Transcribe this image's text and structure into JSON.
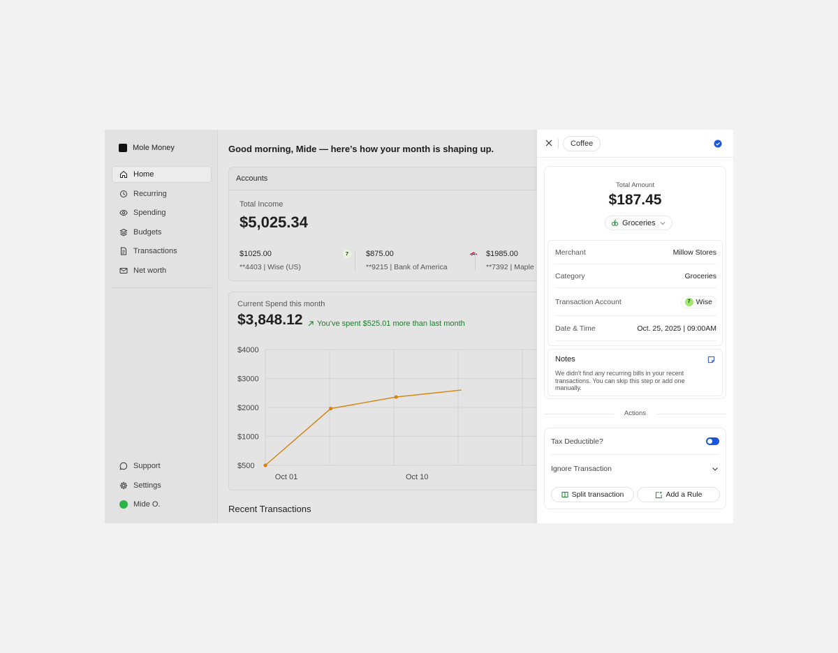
{
  "app": {
    "name": "Mole Money"
  },
  "sidebar": {
    "items": [
      {
        "label": "Home",
        "icon": "home-icon",
        "active": true
      },
      {
        "label": "Recurring",
        "icon": "recurring-icon"
      },
      {
        "label": "Spending",
        "icon": "eye-icon"
      },
      {
        "label": "Budgets",
        "icon": "layers-icon"
      },
      {
        "label": "Transactions",
        "icon": "document-icon"
      },
      {
        "label": "Net worth",
        "icon": "mail-icon"
      }
    ],
    "bottom": [
      {
        "label": "Support",
        "icon": "chat-icon"
      },
      {
        "label": "Settings",
        "icon": "gear-icon"
      },
      {
        "label": "Mide O.",
        "icon": "avatar"
      }
    ]
  },
  "main": {
    "greeting": "Good morning, Mide — here’s how your month is shaping up.",
    "accounts": {
      "title": "Accounts",
      "income_label": "Total Income",
      "income_value": "$5,025.34",
      "list": [
        {
          "amount": "$1025.00",
          "detail": "**4403 | Wise (US)",
          "icon": "wise-icon"
        },
        {
          "amount": "$875.00",
          "detail": "**9215 | Bank of America",
          "icon": "bofa-icon"
        },
        {
          "amount": "$1985.00",
          "detail": "**7392 | Maple",
          "icon": ""
        }
      ]
    },
    "spend": {
      "label": "Current Spend this month",
      "value": "$3,848.12",
      "trend": "You’ve spent $525.01 more than last month",
      "trend_color": "#1d7a2c"
    },
    "recent_title": "Recent Transactions"
  },
  "chart_data": {
    "type": "line",
    "y_ticks": [
      "$4000",
      "$3000",
      "$2000",
      "$1000",
      "$500"
    ],
    "x_ticks": [
      "Oct 01",
      "Oct 10"
    ],
    "x": [
      1,
      7,
      13,
      19
    ],
    "values": [
      500,
      1960,
      2360,
      2600
    ],
    "line_color": "#d4820a",
    "grid": true
  },
  "panel": {
    "chip": "Coffee",
    "total_label": "Total Amount",
    "total_value": "$187.45",
    "category_chip": "Groceries",
    "details": [
      {
        "key": "Merchant",
        "value": "Millow Stores"
      },
      {
        "key": "Category",
        "value": "Groceries"
      },
      {
        "key": "Transaction Account",
        "value": "Wise",
        "badge": true
      },
      {
        "key": "Date & Time",
        "value": "Oct. 25, 2025 | 09:00AM"
      }
    ],
    "notes_title": "Notes",
    "notes_body": "We didn't find any recurring bills in your recent transactions. You can skip this step or add one manually.",
    "actions_label": "Actions",
    "tax_label": "Tax Deductible?",
    "ignore_label": "Ignore Transaction",
    "split_label": "Split transaction",
    "rule_label": "Add a Rule",
    "accent": "#1a56db"
  }
}
